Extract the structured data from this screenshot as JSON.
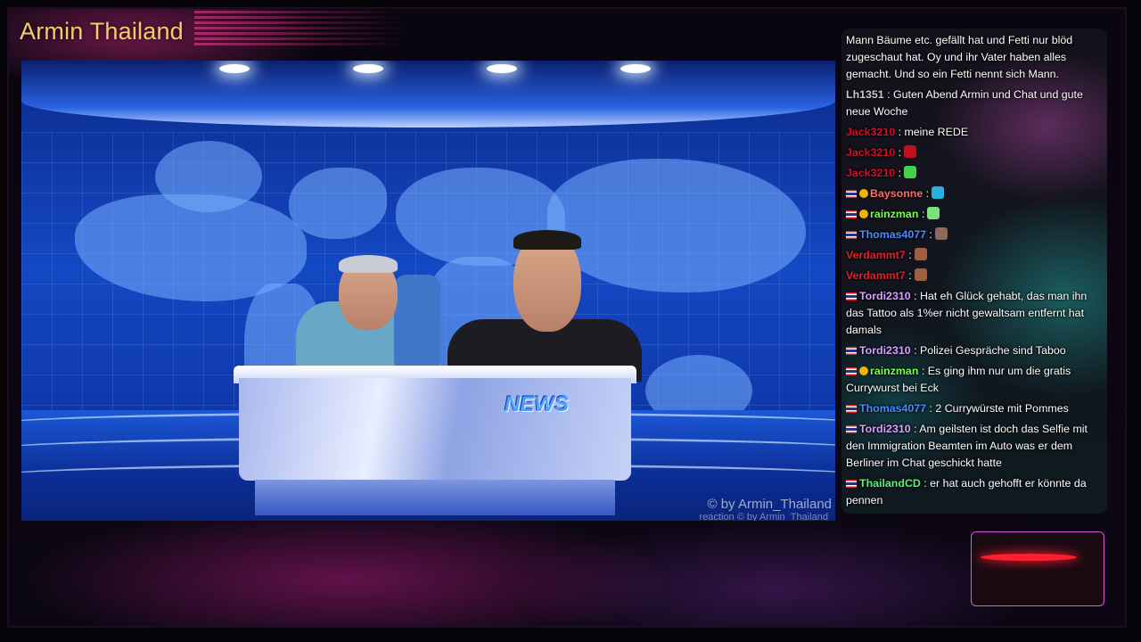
{
  "stream": {
    "title": "Armin Thailand"
  },
  "video": {
    "desk_label": "NEWS",
    "watermark": "© by Armin_Thailand",
    "watermark_small": "reaction  © by Armin_Thailand"
  },
  "colors": {
    "title": "#f6cb6a",
    "accent_pink": "#d35bd8",
    "studio_blue": "#1448c4"
  },
  "chat": {
    "messages": [
      {
        "user": "",
        "user_color": "#ffffff",
        "text": "Mann Bäume etc. gefällt hat und Fetti nur blöd zugeschaut hat. Oy und ihr Vater haben alles gemacht. Und so ein Fetti nennt sich Mann."
      },
      {
        "user": "Lh1351",
        "user_color": "#c8c8c8",
        "text": " : Guten Abend Armin und Chat und gute neue Woche"
      },
      {
        "user": "Jack3210",
        "user_color": "#d0102a",
        "text": " : meine REDE"
      },
      {
        "user": "Jack3210",
        "user_color": "#d0102a",
        "text": " :",
        "emote": "#c0101a"
      },
      {
        "user": "Jack3210",
        "user_color": "#d0102a",
        "text": " :",
        "emote": "#42d14a"
      },
      {
        "user": "Baysonne",
        "user_color": "#ff6b6b",
        "text": " :",
        "emote": "#2ab0e0",
        "flag": true,
        "badge": true
      },
      {
        "user": "rainzman",
        "user_color": "#7cfc4a",
        "text": " :",
        "emote": "#7ce07c",
        "flag": true,
        "badge": true
      },
      {
        "user": "Thomas4077",
        "user_color": "#4a8cff",
        "text": " :",
        "emote": "#8c6a5a",
        "flag": true
      },
      {
        "user": "Verdammt7",
        "user_color": "#e0202a",
        "text": " :",
        "emote": "#a06040"
      },
      {
        "user": "Verdammt7",
        "user_color": "#e0202a",
        "text": " :",
        "emote": "#a06040"
      },
      {
        "user": "Tordi2310",
        "user_color": "#d8a0ff",
        "text": " : Hat eh Glück gehabt, das man ihn das Tattoo als 1%er nicht gewaltsam entfernt hat damals",
        "flag": true
      },
      {
        "user": "Tordi2310",
        "user_color": "#d8a0ff",
        "text": " : Polizei Gespräche sind Taboo",
        "flag": true
      },
      {
        "user": "rainzman",
        "user_color": "#7cfc4a",
        "text": " : Es ging ihm nur um die gratis Currywurst bei Eck",
        "flag": true,
        "badge": true
      },
      {
        "user": "Thomas4077",
        "user_color": "#4a8cff",
        "text": " : 2 Currywürste mit Pommes",
        "flag": true
      },
      {
        "user": "Tordi2310",
        "user_color": "#d8a0ff",
        "text": " : Am geilsten ist doch das Selfie mit den Immigration Beamten im Auto was er dem Berliner im Chat geschickt hatte",
        "flag": true
      },
      {
        "user": "ThailandCD",
        "user_color": "#5cf07a",
        "text": " : er hat auch gehofft er könnte da pennen",
        "flag": true
      }
    ]
  }
}
